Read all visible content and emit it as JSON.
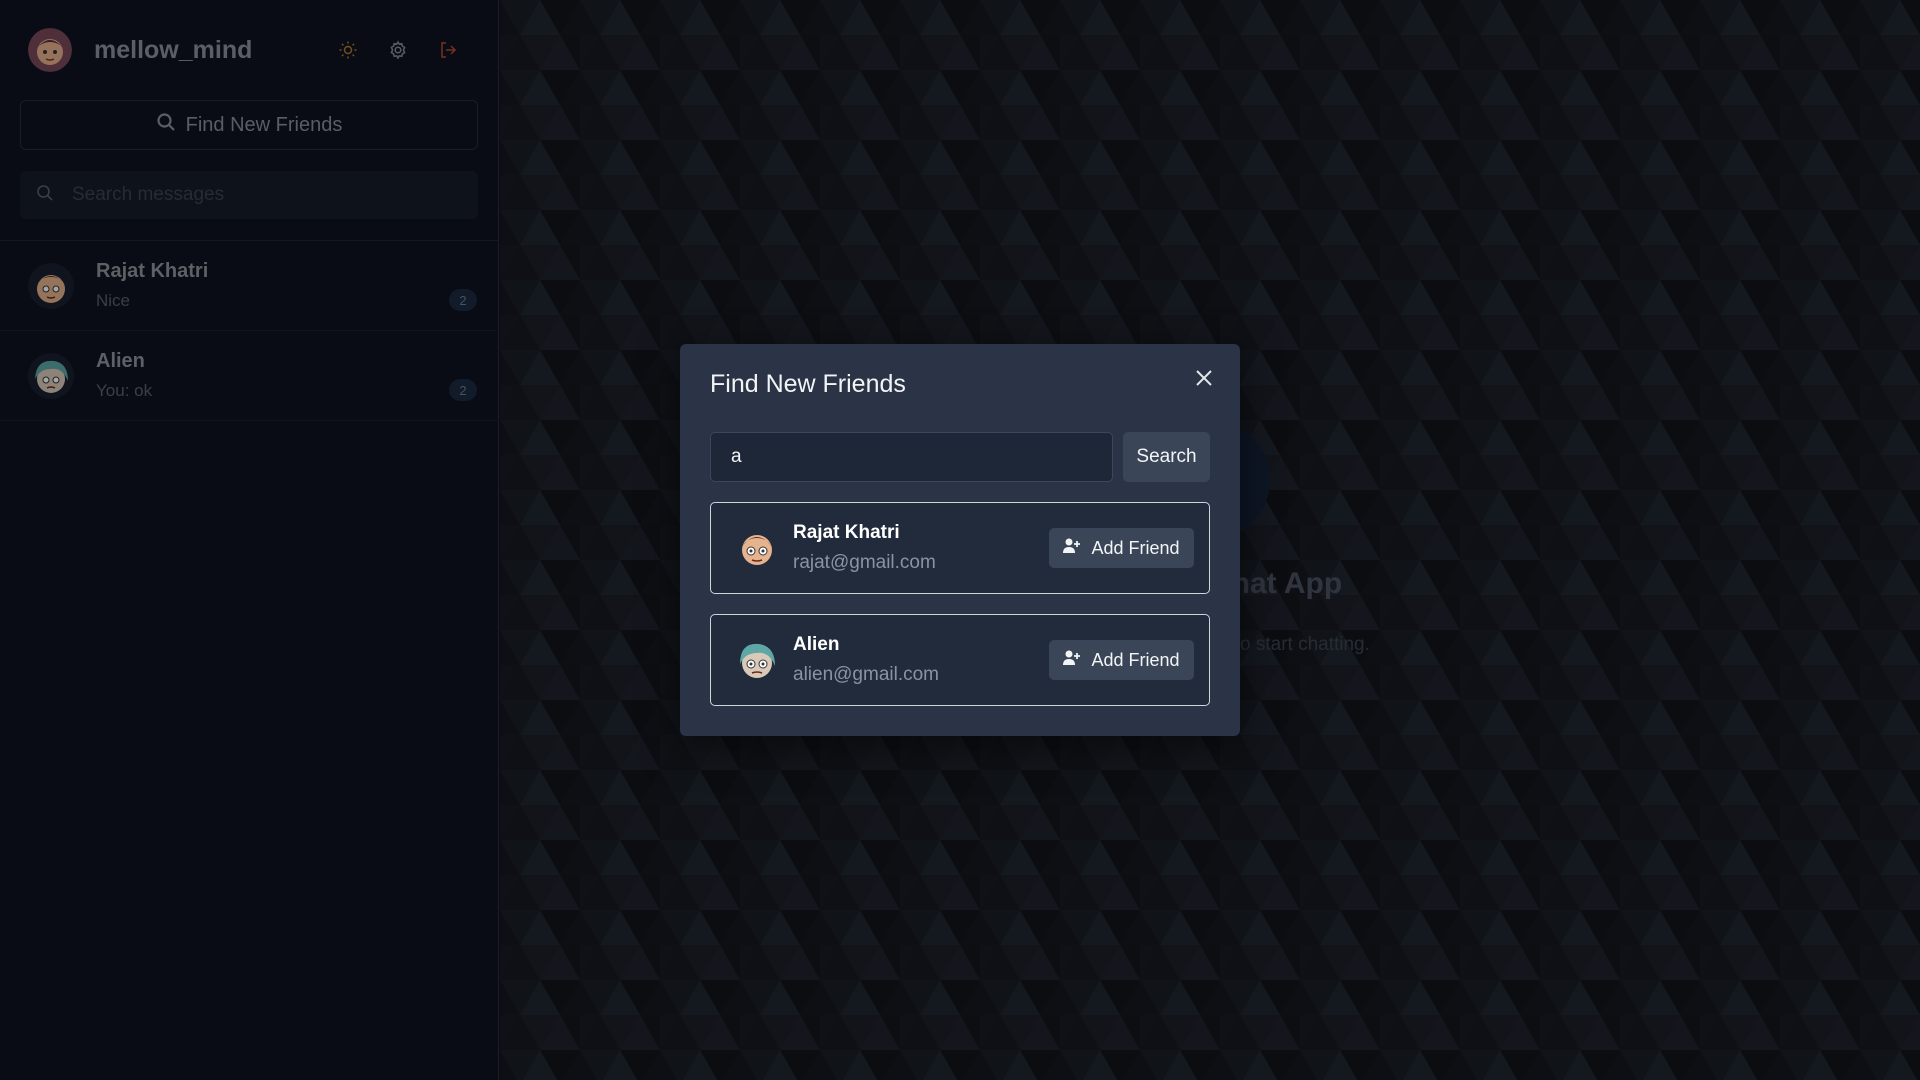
{
  "colors": {
    "sidebar_bg": "#0e1320",
    "modal_bg": "#2a3446",
    "accent_logout": "#b84a2e",
    "accent_theme": "#b07a2a"
  },
  "sidebar": {
    "username": "mellow_mind",
    "icons": [
      "sun-icon",
      "gear-icon",
      "logout-icon"
    ],
    "find_friends_label": "Find New Friends",
    "search_placeholder": "Search messages",
    "chats": [
      {
        "name": "Rajat Khatri",
        "preview": "Nice",
        "unread": "2"
      },
      {
        "name": "Alien",
        "preview": "You: ok",
        "unread": "2"
      }
    ]
  },
  "main": {
    "welcome_title": "Chat App",
    "welcome_subtitle": "o start chatting."
  },
  "modal": {
    "title": "Find New Friends",
    "search_value": "a",
    "search_button": "Search",
    "results": [
      {
        "name": "Rajat Khatri",
        "email": "rajat@gmail.com",
        "button": "Add Friend"
      },
      {
        "name": "Alien",
        "email": "alien@gmail.com",
        "button": "Add Friend"
      }
    ]
  }
}
